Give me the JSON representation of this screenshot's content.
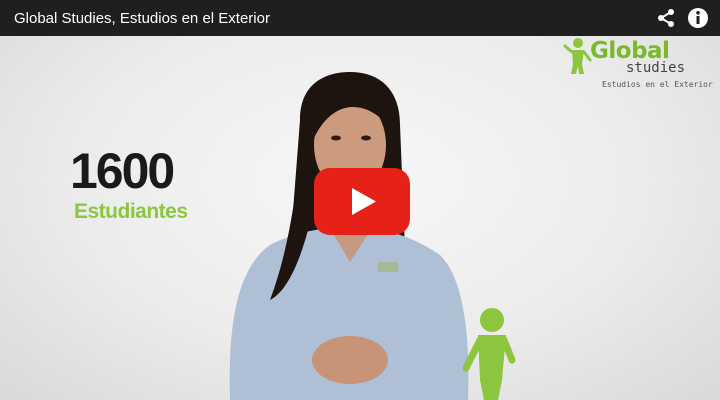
{
  "video": {
    "title": "Global Studies, Estudios en el Exterior"
  },
  "overlay": {
    "stat_number": "1600",
    "stat_label": "Estudiantes"
  },
  "logo": {
    "line1": "Global",
    "line2": "studies",
    "tagline": "Estudios en el Exterior"
  },
  "icons": {
    "share": "share-icon",
    "info": "info-icon",
    "play": "play-icon"
  },
  "colors": {
    "topbar": "#1f1f1f",
    "play_red": "#e62117",
    "brand_green": "#8cc63f"
  }
}
